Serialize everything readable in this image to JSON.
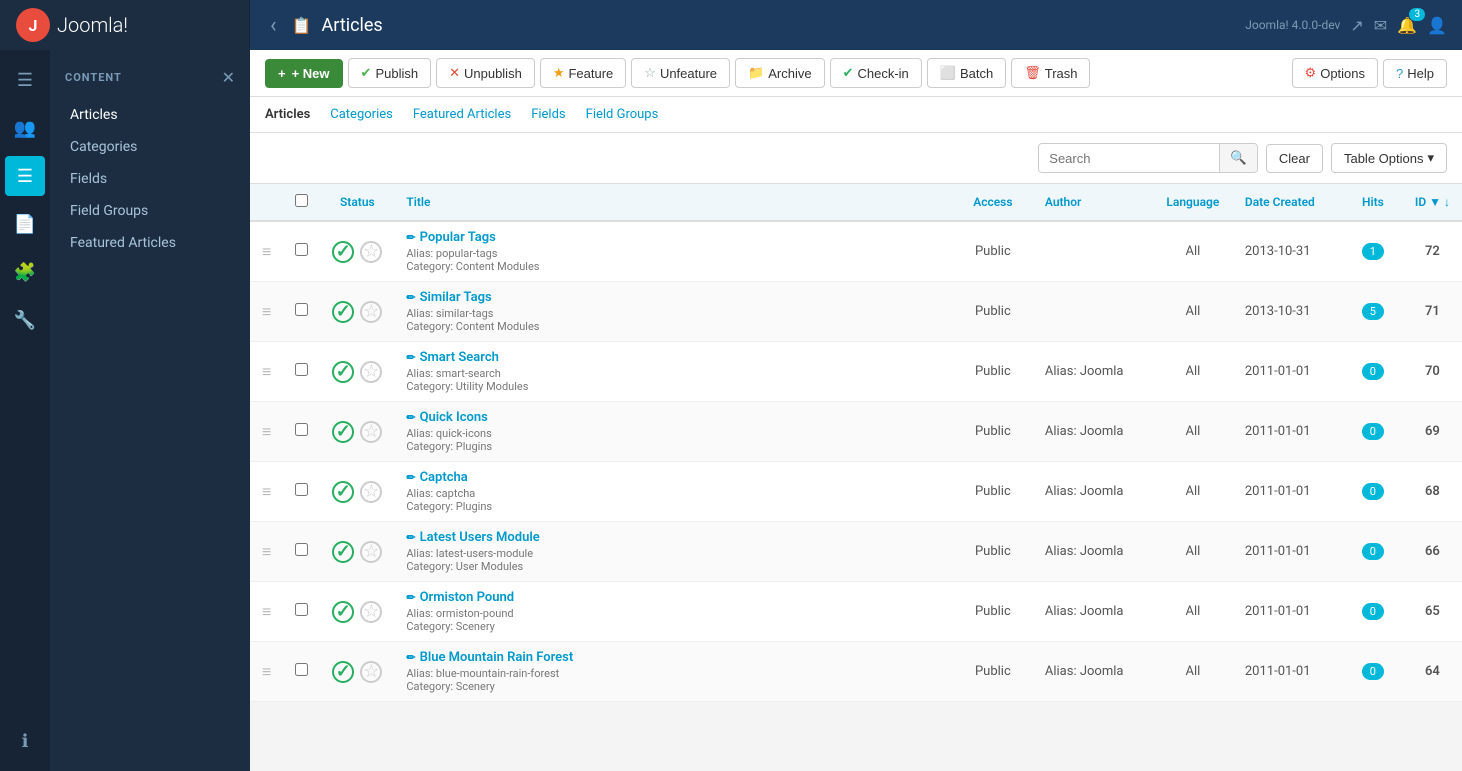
{
  "brand": {
    "logo_text": "Joomla!",
    "version": "Joomla! 4.0.0-dev"
  },
  "topbar": {
    "back_label": "‹",
    "page_icon": "📋",
    "title": "Articles",
    "notification_count": "3"
  },
  "toolbar": {
    "new_label": "+ New",
    "publish_label": "Publish",
    "unpublish_label": "Unpublish",
    "feature_label": "Feature",
    "unfeature_label": "Unfeature",
    "archive_label": "Archive",
    "checkin_label": "Check-in",
    "batch_label": "Batch",
    "trash_label": "Trash",
    "options_label": "Options",
    "help_label": "Help"
  },
  "subnav": {
    "items": [
      {
        "label": "Articles",
        "active": true
      },
      {
        "label": "Categories",
        "active": false
      },
      {
        "label": "Featured Articles",
        "active": false
      },
      {
        "label": "Fields",
        "active": false
      },
      {
        "label": "Field Groups",
        "active": false
      }
    ]
  },
  "sidebar": {
    "section_title": "CONTENT",
    "nav_items": [
      {
        "label": "Articles",
        "active": true
      },
      {
        "label": "Categories",
        "active": false
      },
      {
        "label": "Fields",
        "active": false
      },
      {
        "label": "Field Groups",
        "active": false
      },
      {
        "label": "Featured Articles",
        "active": false
      }
    ]
  },
  "search": {
    "placeholder": "Search",
    "clear_label": "Clear",
    "table_options_label": "Table Options"
  },
  "table": {
    "columns": [
      {
        "label": "",
        "key": "drag"
      },
      {
        "label": "",
        "key": "check"
      },
      {
        "label": "Status",
        "key": "status"
      },
      {
        "label": "Title",
        "key": "title"
      },
      {
        "label": "Access",
        "key": "access"
      },
      {
        "label": "Author",
        "key": "author"
      },
      {
        "label": "Language",
        "key": "language"
      },
      {
        "label": "Date Created",
        "key": "date_created"
      },
      {
        "label": "Hits",
        "key": "hits"
      },
      {
        "label": "ID ▼",
        "key": "id"
      }
    ],
    "rows": [
      {
        "id": "72",
        "title": "Popular Tags",
        "alias": "popular-tags",
        "category": "Content Modules",
        "access": "Public",
        "author": "",
        "language": "All",
        "date_created": "2013-10-31",
        "hits": "1",
        "hits_zero": false
      },
      {
        "id": "71",
        "title": "Similar Tags",
        "alias": "similar-tags",
        "category": "Content Modules",
        "access": "Public",
        "author": "",
        "language": "All",
        "date_created": "2013-10-31",
        "hits": "5",
        "hits_zero": false
      },
      {
        "id": "70",
        "title": "Smart Search",
        "alias": "smart-search",
        "category": "Utility Modules",
        "access": "Public",
        "author": "Alias: Joomla",
        "language": "All",
        "date_created": "2011-01-01",
        "hits": "0",
        "hits_zero": true
      },
      {
        "id": "69",
        "title": "Quick Icons",
        "alias": "quick-icons",
        "category": "Plugins",
        "access": "Public",
        "author": "Alias: Joomla",
        "language": "All",
        "date_created": "2011-01-01",
        "hits": "0",
        "hits_zero": true
      },
      {
        "id": "68",
        "title": "Captcha",
        "alias": "captcha",
        "category": "Plugins",
        "access": "Public",
        "author": "Alias: Joomla",
        "language": "All",
        "date_created": "2011-01-01",
        "hits": "0",
        "hits_zero": true
      },
      {
        "id": "66",
        "title": "Latest Users Module",
        "alias": "latest-users-module",
        "category": "User Modules",
        "access": "Public",
        "author": "Alias: Joomla",
        "language": "All",
        "date_created": "2011-01-01",
        "hits": "0",
        "hits_zero": true
      },
      {
        "id": "65",
        "title": "Ormiston Pound",
        "alias": "ormiston-pound",
        "category": "Scenery",
        "access": "Public",
        "author": "Alias: Joomla",
        "language": "All",
        "date_created": "2011-01-01",
        "hits": "0",
        "hits_zero": true
      },
      {
        "id": "64",
        "title": "Blue Mountain Rain Forest",
        "alias": "blue-mountain-rain-forest",
        "category": "Scenery",
        "access": "Public",
        "author": "Alias: Joomla",
        "language": "All",
        "date_created": "2011-01-01",
        "hits": "0",
        "hits_zero": true
      }
    ]
  },
  "icons": {
    "menu": "☰",
    "users": "👥",
    "list": "☰",
    "content": "📄",
    "components": "🧩",
    "extensions": "🔧",
    "info": "ℹ",
    "drag": "≡",
    "check_circle": "✔",
    "star_empty": "☆",
    "edit_pencil": "✏",
    "search": "🔍",
    "notification": "🔔",
    "message": "✉",
    "user": "👤",
    "external": "↗"
  }
}
